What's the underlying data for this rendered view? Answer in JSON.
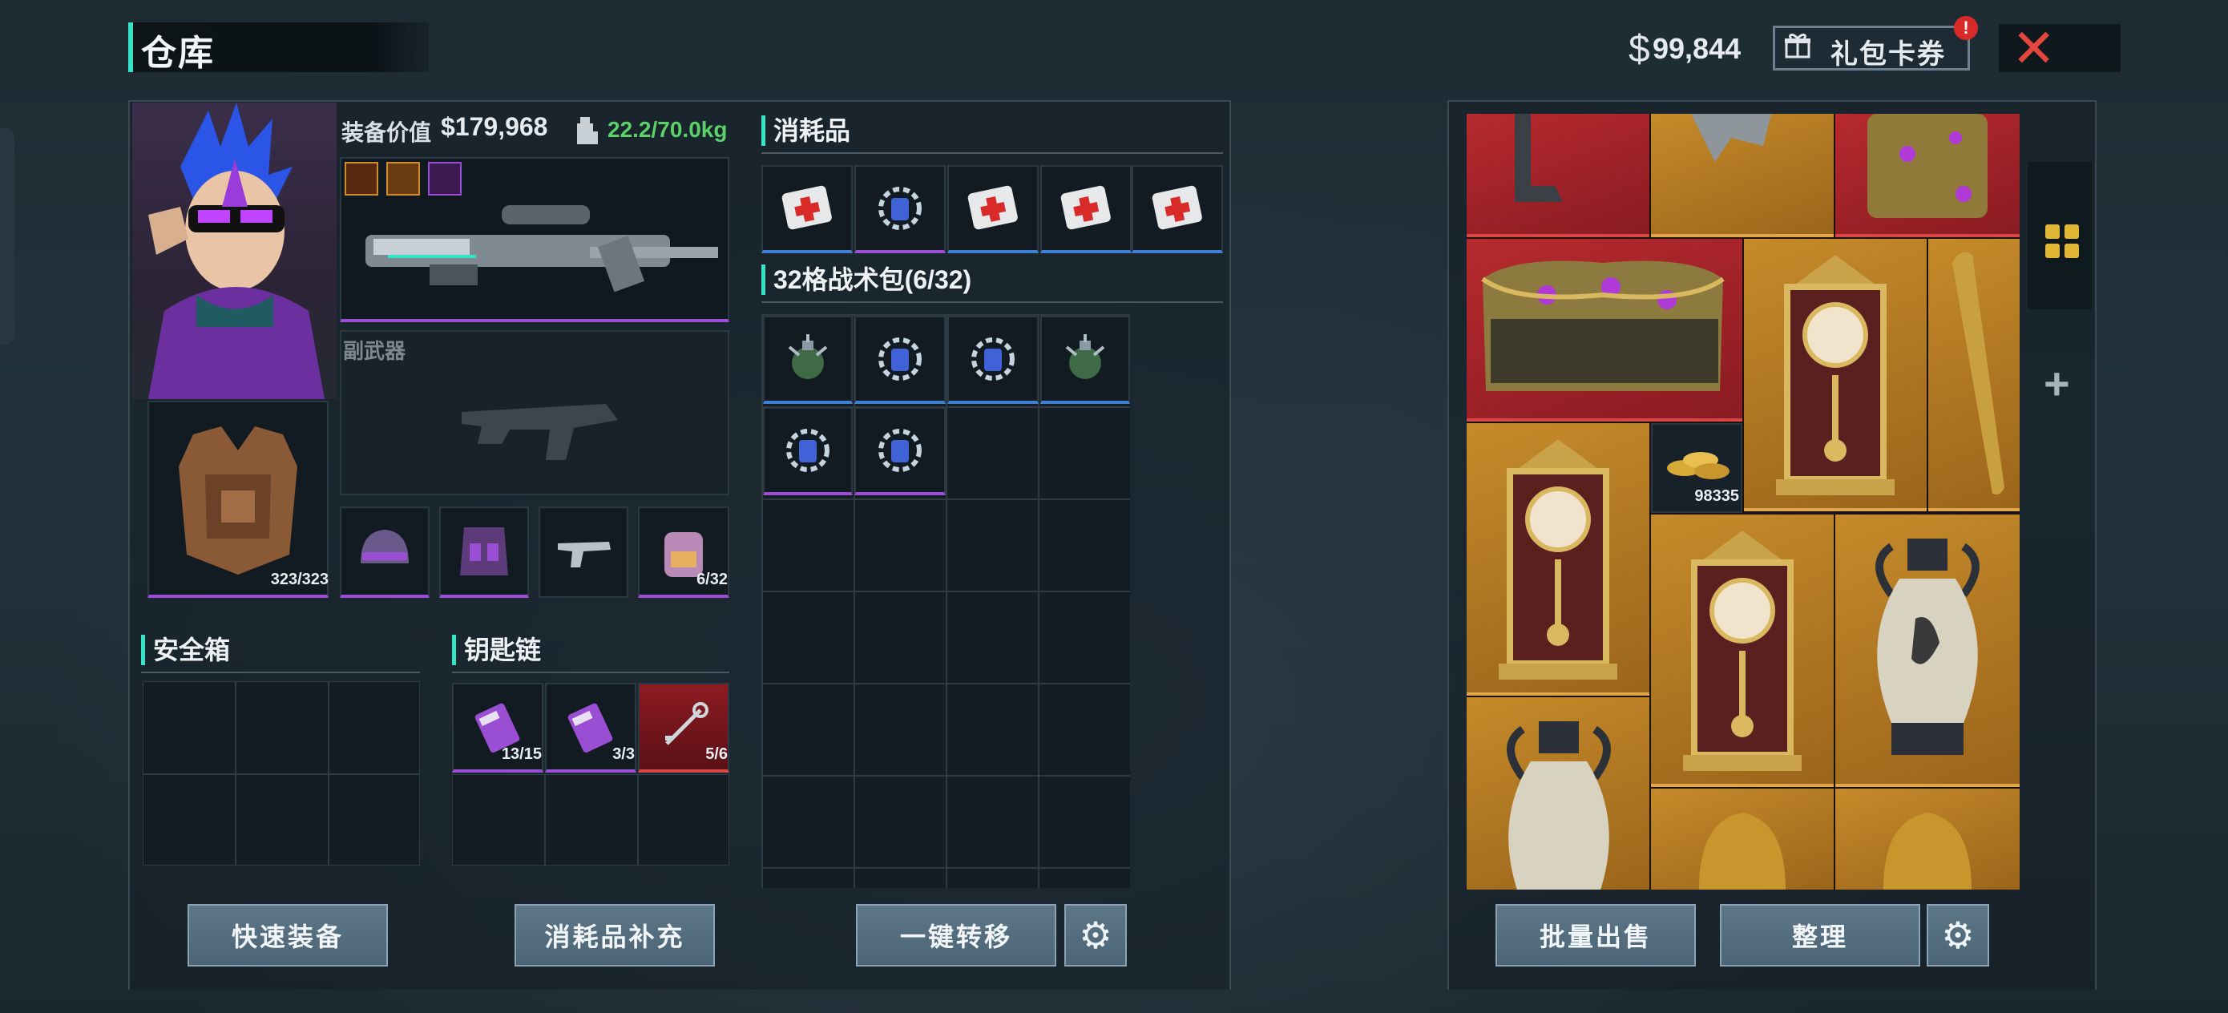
{
  "header": {
    "title": "仓库",
    "money_symbol": "$",
    "money": "99,844",
    "gift_button": "礼包卡券",
    "gift_badge": "!",
    "close_icon": "close-icon"
  },
  "loadout": {
    "equip_value_label": "装备价值",
    "equip_value": "$179,968",
    "weight": "22.2/70.0kg",
    "secondary_weapon_label": "副武器",
    "armor_durability": "323/323",
    "backpack_capacity": "6/32"
  },
  "consumables": {
    "title": "消耗品",
    "items": [
      "medkit-icon",
      "gear-crystal-icon",
      "medkit-icon",
      "medkit-icon",
      "medkit-icon"
    ]
  },
  "tactical_bag": {
    "title": "32格战术包(6/32)",
    "items": [
      "grenade-icon",
      "gear-crystal-icon",
      "gear-crystal-icon",
      "grenade-icon",
      "gear-crystal-icon",
      "gear-crystal-icon"
    ]
  },
  "safe_box": {
    "title": "安全箱"
  },
  "keychain": {
    "title": "钥匙链",
    "items": [
      {
        "icon": "keycard-icon",
        "qty": "13/15"
      },
      {
        "icon": "keycard-icon",
        "qty": "3/3"
      },
      {
        "icon": "key-icon",
        "qty": "5/6"
      }
    ]
  },
  "stash": {
    "gold_coins_qty": "98335"
  },
  "buttons": {
    "quick_equip": "快速装备",
    "refill_consumables": "消耗品补充",
    "one_click_transfer": "一键转移",
    "bulk_sell": "批量出售",
    "sort": "整理"
  },
  "colors": {
    "accent": "#35e3c6",
    "weight_green": "#5bd16a",
    "rarity_purple": "#9a4ed3",
    "rarity_blue": "#3f7fd6",
    "rarity_red": "#d94646",
    "stash_red": "#a8262b",
    "stash_gold": "#b97d24",
    "close_red": "#e2463c"
  }
}
